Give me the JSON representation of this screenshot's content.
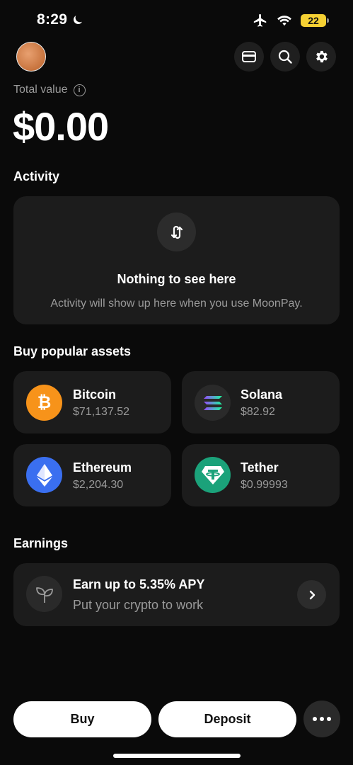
{
  "status_bar": {
    "time": "8:29",
    "battery": "22"
  },
  "header": {
    "icons": [
      "card-icon",
      "search-icon",
      "gear-icon"
    ]
  },
  "portfolio": {
    "total_label": "Total value",
    "total_value": "$0.00"
  },
  "activity": {
    "section_title": "Activity",
    "empty_title": "Nothing to see here",
    "empty_subtitle": "Activity will show up here when you use MoonPay."
  },
  "assets": {
    "section_title": "Buy popular assets",
    "items": [
      {
        "name": "Bitcoin",
        "price": "$71,137.52",
        "color": "#f7931a",
        "icon": "bitcoin-icon"
      },
      {
        "name": "Solana",
        "price": "$82.92",
        "color": "#2a2a2a",
        "icon": "solana-icon"
      },
      {
        "name": "Ethereum",
        "price": "$2,204.30",
        "color": "#3a6ff0",
        "icon": "ethereum-icon"
      },
      {
        "name": "Tether",
        "price": "$0.99993",
        "color": "#1ba27a",
        "icon": "tether-icon"
      }
    ]
  },
  "earnings": {
    "section_title": "Earnings",
    "title": "Earn up to 5.35% APY",
    "subtitle": "Put your crypto to work"
  },
  "actions": {
    "buy": "Buy",
    "deposit": "Deposit"
  }
}
